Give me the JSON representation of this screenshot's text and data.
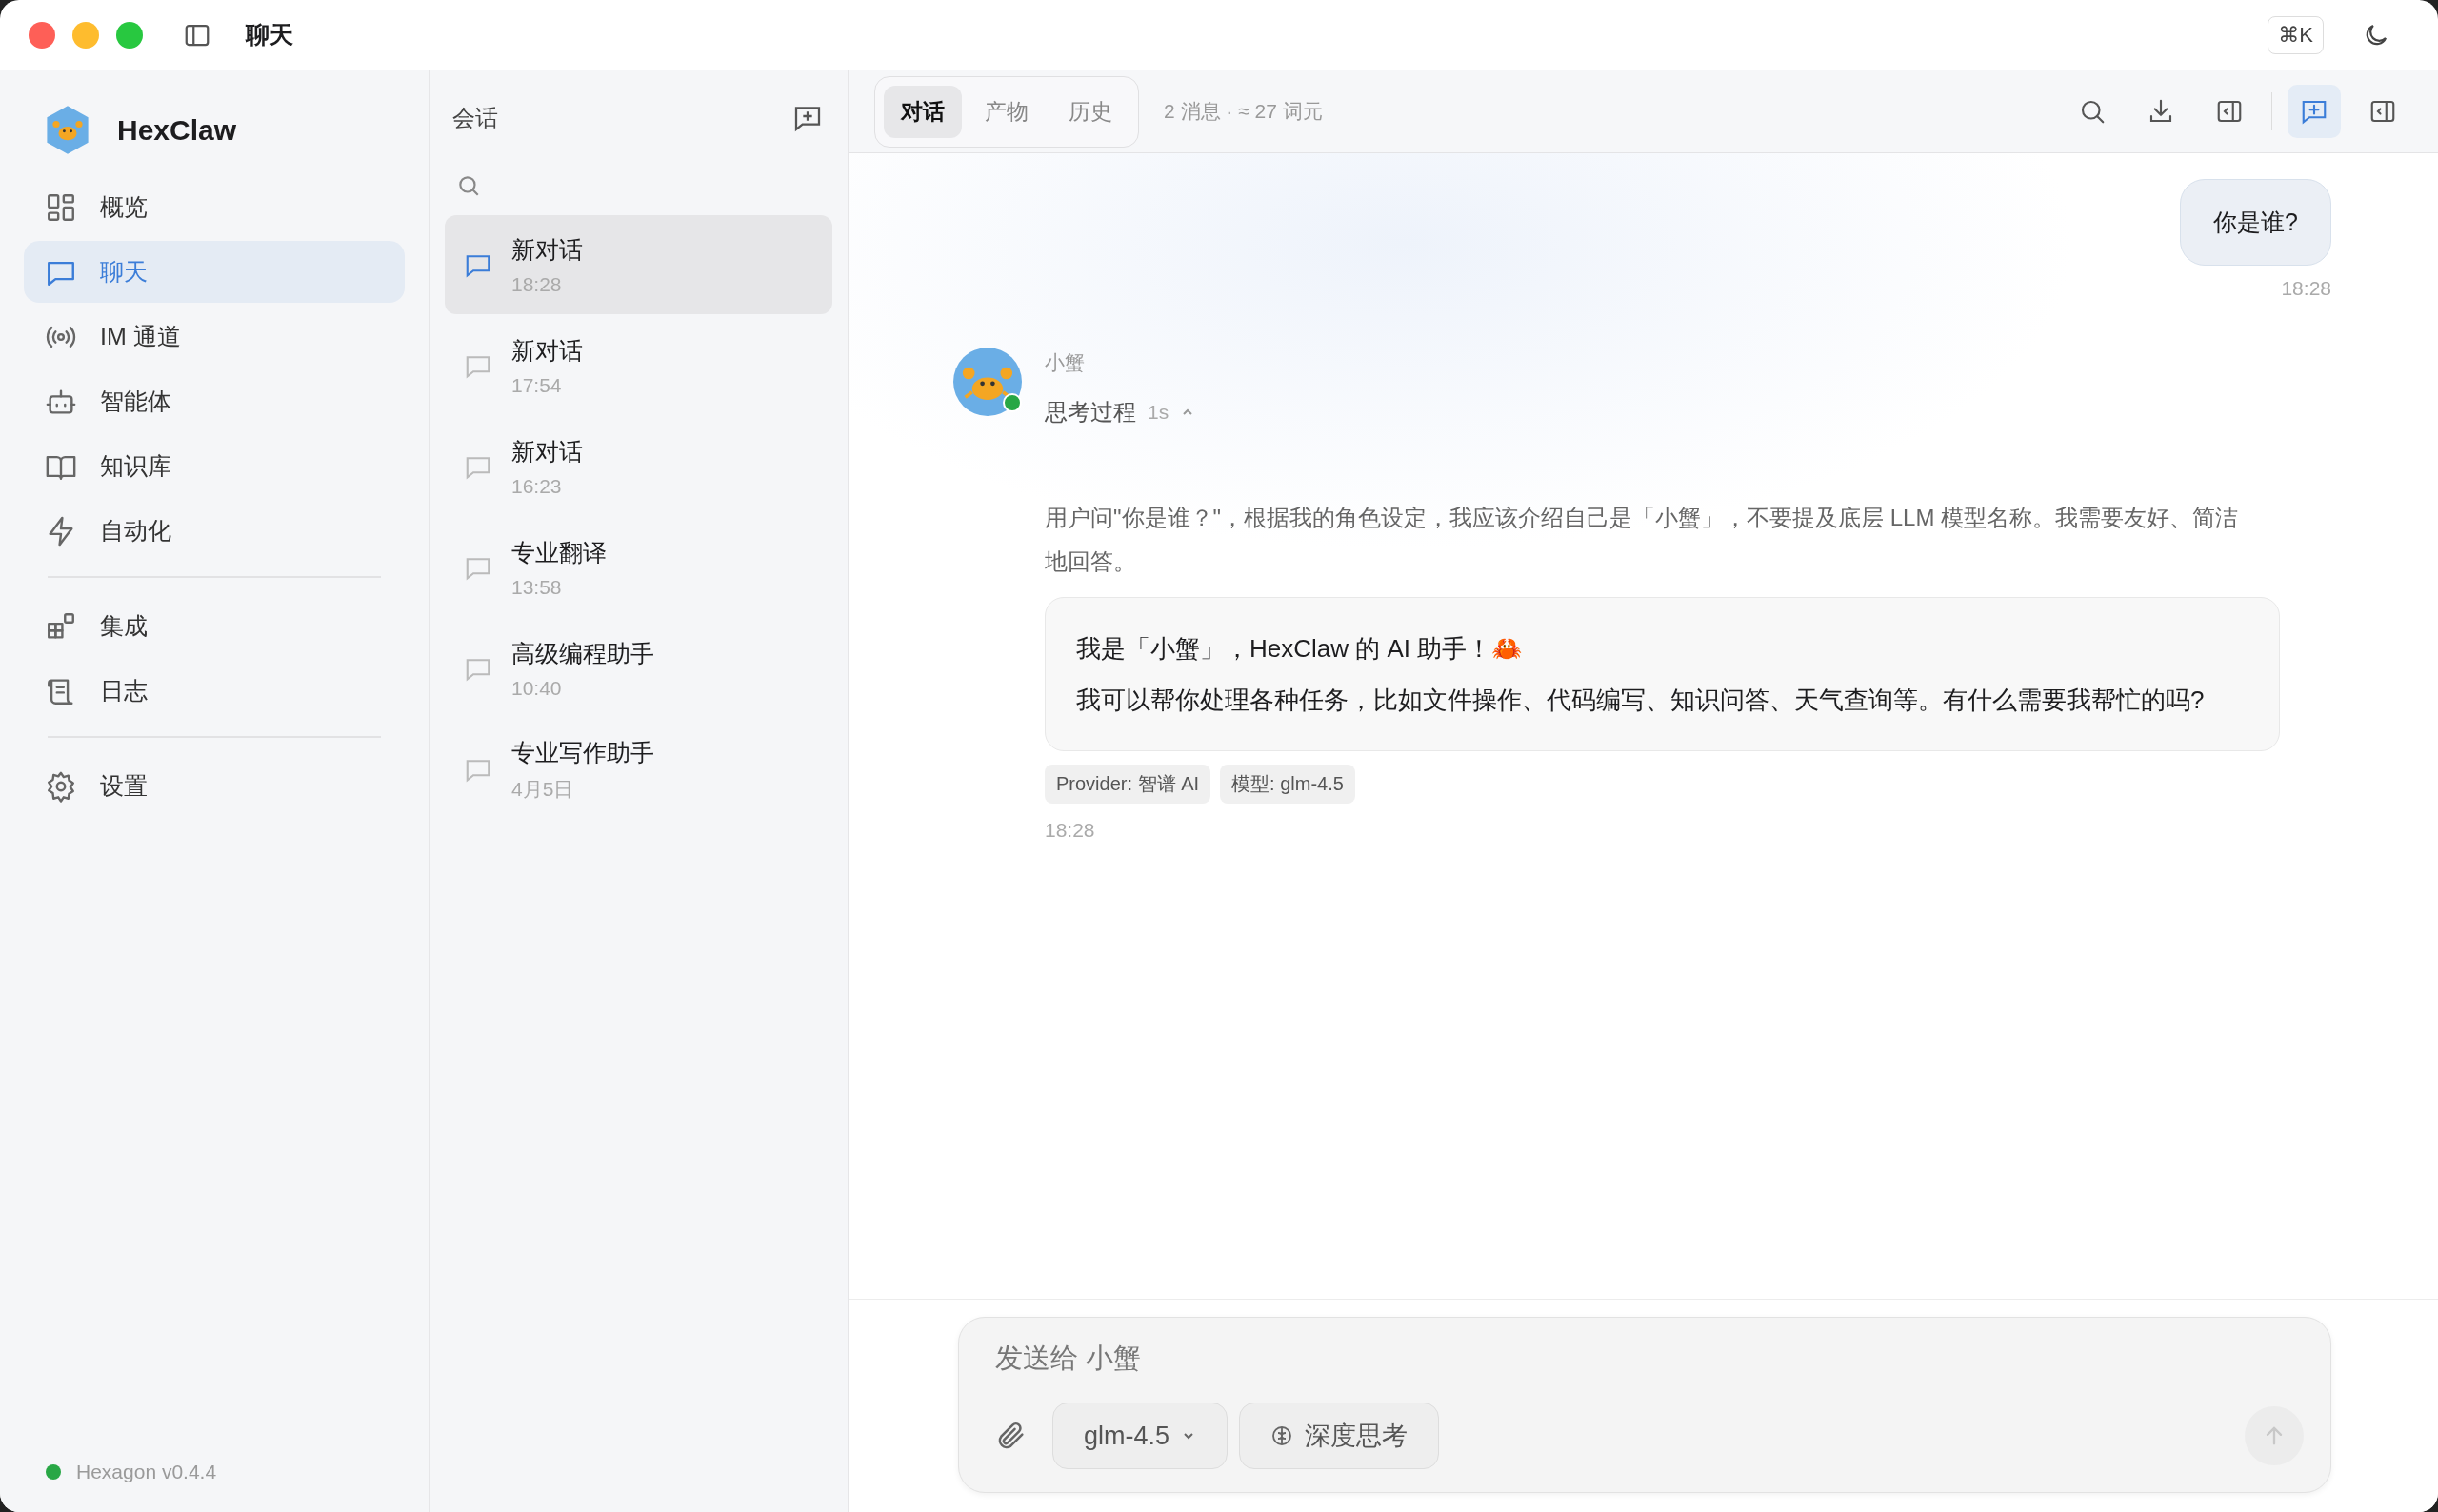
{
  "window": {
    "title": "聊天",
    "shortcut": "⌘K"
  },
  "sidebar": {
    "app_name": "HexClaw",
    "groups": [
      {
        "items": [
          {
            "label": "概览",
            "selected": false
          },
          {
            "label": "聊天",
            "selected": true
          },
          {
            "label": "IM 通道",
            "selected": false
          },
          {
            "label": "智能体",
            "selected": false
          },
          {
            "label": "知识库",
            "selected": false
          },
          {
            "label": "自动化",
            "selected": false
          }
        ]
      },
      {
        "items": [
          {
            "label": "集成",
            "selected": false
          },
          {
            "label": "日志",
            "selected": false
          }
        ]
      },
      {
        "items": [
          {
            "label": "设置",
            "selected": false
          }
        ]
      }
    ],
    "status": {
      "label": "Hexagon v0.4.4",
      "color": "#28a745"
    }
  },
  "conversations": {
    "title": "会话",
    "items": [
      {
        "title": "新对话",
        "time": "18:28",
        "selected": true
      },
      {
        "title": "新对话",
        "time": "17:54",
        "selected": false
      },
      {
        "title": "新对话",
        "time": "16:23",
        "selected": false
      },
      {
        "title": "专业翻译",
        "time": "13:58",
        "selected": false
      },
      {
        "title": "高级编程助手",
        "time": "10:40",
        "selected": false
      },
      {
        "title": "专业写作助手",
        "time": "4月5日",
        "selected": false
      }
    ]
  },
  "chat": {
    "tabs": [
      {
        "label": "对话",
        "selected": true
      },
      {
        "label": "产物",
        "selected": false
      },
      {
        "label": "历史",
        "selected": false
      }
    ],
    "stats": "2 消息 · ≈ 27 词元",
    "toolbar": [
      {
        "selected": false
      },
      {
        "selected": false
      },
      {
        "selected": false
      },
      {
        "selected": true
      },
      {
        "selected": false
      }
    ],
    "messages": [
      {
        "kind": "user",
        "text": "你是谁?",
        "time": "18:28"
      },
      {
        "kind": "assistant",
        "name": "小蟹",
        "online": true,
        "thinking": {
          "label": "思考过程",
          "duration": "1s",
          "expanded": true,
          "text": "用户问\"你是谁？\"，根据我的角色设定，我应该介绍自己是「小蟹」，不要提及底层 LLM 模型名称。我需要友好、简洁地回答。"
        },
        "paragraphs": [
          "我是「小蟹」，HexClaw 的 AI 助手！🦀",
          "我可以帮你处理各种任务，比如文件操作、代码编写、知识问答、天气查询等。有什么需要我帮忙的吗?"
        ],
        "tags": [
          "Provider: 智谱 AI",
          "模型: glm-4.5"
        ],
        "time": "18:28"
      }
    ],
    "composer": {
      "placeholder": "发送给 小蟹",
      "model": "glm-4.5",
      "deep_think": "深度思考",
      "send_disabled": true
    }
  }
}
